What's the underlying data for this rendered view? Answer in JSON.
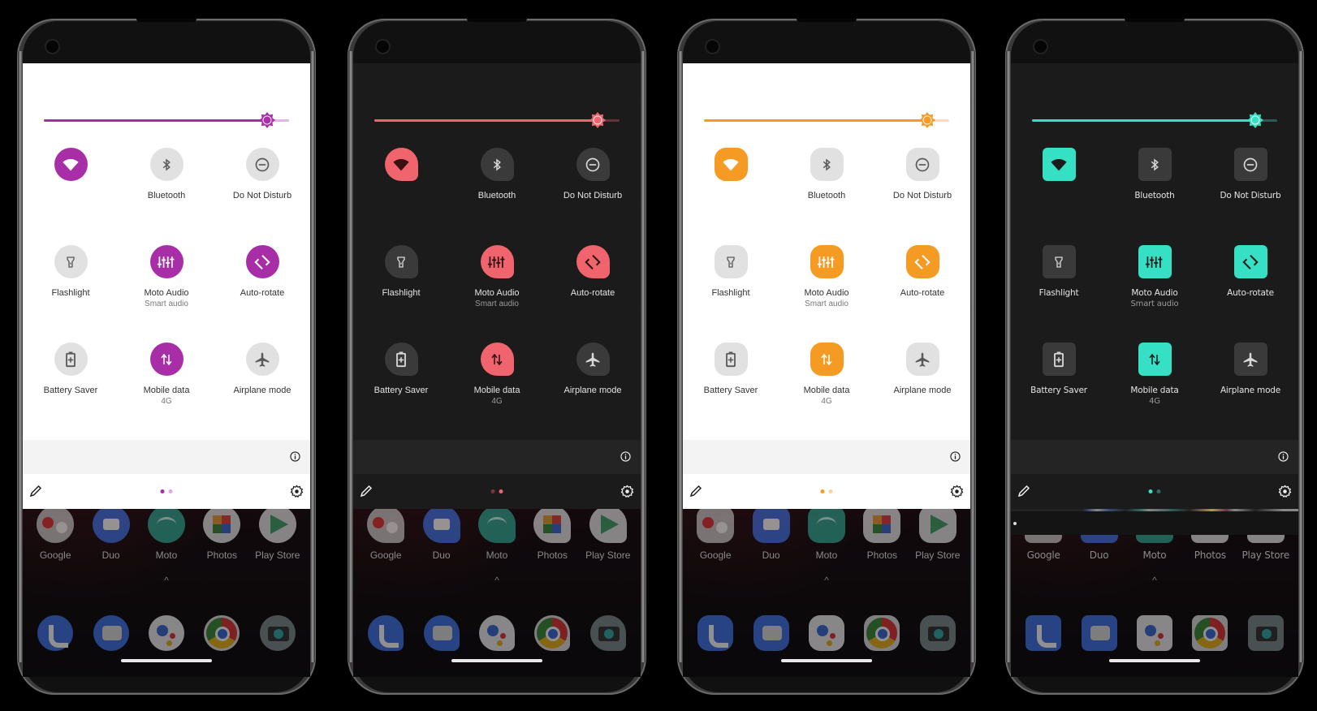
{
  "phones": [
    {
      "theme": "light",
      "shape": "circle",
      "accent": "#a82ea8",
      "accent_dim": "#e2a9e2",
      "brightness": 0.91,
      "tiles": [
        {
          "icon": "wifi",
          "name": "",
          "sub": "",
          "on": true
        },
        {
          "icon": "bluetooth",
          "name": "Bluetooth",
          "sub": "",
          "on": false
        },
        {
          "icon": "dnd",
          "name": "Do Not Disturb",
          "sub": "",
          "on": false
        },
        {
          "icon": "flashlight",
          "name": "Flashlight",
          "sub": "",
          "on": false
        },
        {
          "icon": "equalizer",
          "name": "Moto Audio",
          "sub": "Smart audio",
          "on": true
        },
        {
          "icon": "rotate",
          "name": "Auto-rotate",
          "sub": "",
          "on": true
        },
        {
          "icon": "battery",
          "name": "Battery Saver",
          "sub": "",
          "on": false
        },
        {
          "icon": "data",
          "name": "Mobile data",
          "sub": "4G",
          "on": true
        },
        {
          "icon": "airplane",
          "name": "Airplane mode",
          "sub": "",
          "on": false
        }
      ],
      "page_dots": {
        "count": 2,
        "active": 0
      }
    },
    {
      "theme": "dark",
      "shape": "drop",
      "accent": "#f0656d",
      "accent_dim": "#7a3539",
      "brightness": 0.91,
      "tiles": [
        {
          "icon": "wifi",
          "name": "",
          "sub": "",
          "on": true
        },
        {
          "icon": "bluetooth",
          "name": "Bluetooth",
          "sub": "",
          "on": false
        },
        {
          "icon": "dnd",
          "name": "Do Not Disturb",
          "sub": "",
          "on": false
        },
        {
          "icon": "flashlight",
          "name": "Flashlight",
          "sub": "",
          "on": false
        },
        {
          "icon": "equalizer",
          "name": "Moto Audio",
          "sub": "Smart audio",
          "on": true
        },
        {
          "icon": "rotate",
          "name": "Auto-rotate",
          "sub": "",
          "on": true
        },
        {
          "icon": "battery",
          "name": "Battery Saver",
          "sub": "",
          "on": false
        },
        {
          "icon": "data",
          "name": "Mobile data",
          "sub": "4G",
          "on": true
        },
        {
          "icon": "airplane",
          "name": "Airplane mode",
          "sub": "",
          "on": false
        }
      ],
      "page_dots": {
        "count": 2,
        "active": 1
      }
    },
    {
      "theme": "light",
      "shape": "squircle",
      "accent": "#f59a23",
      "accent_dim": "#f7d3a3",
      "brightness": 0.91,
      "tiles": [
        {
          "icon": "wifi",
          "name": "",
          "sub": "",
          "on": true
        },
        {
          "icon": "bluetooth",
          "name": "Bluetooth",
          "sub": "",
          "on": false
        },
        {
          "icon": "dnd",
          "name": "Do Not Disturb",
          "sub": "",
          "on": false
        },
        {
          "icon": "flashlight",
          "name": "Flashlight",
          "sub": "",
          "on": false
        },
        {
          "icon": "equalizer",
          "name": "Moto Audio",
          "sub": "Smart audio",
          "on": true
        },
        {
          "icon": "rotate",
          "name": "Auto-rotate",
          "sub": "",
          "on": true
        },
        {
          "icon": "battery",
          "name": "Battery Saver",
          "sub": "",
          "on": false
        },
        {
          "icon": "data",
          "name": "Mobile data",
          "sub": "4G",
          "on": true
        },
        {
          "icon": "airplane",
          "name": "Airplane mode",
          "sub": "",
          "on": false
        }
      ],
      "page_dots": {
        "count": 2,
        "active": 0
      }
    },
    {
      "theme": "dark",
      "shape": "square",
      "accent": "#35e0c4",
      "accent_dim": "#2b6e62",
      "brightness": 0.91,
      "alt_font": true,
      "tiles": [
        {
          "icon": "wifi",
          "name": "",
          "sub": "",
          "on": true
        },
        {
          "icon": "bluetooth",
          "name": "Bluetooth",
          "sub": "",
          "on": false
        },
        {
          "icon": "dnd",
          "name": "Do Not Disturb",
          "sub": "",
          "on": false
        },
        {
          "icon": "flashlight",
          "name": "Flashlight",
          "sub": "",
          "on": false
        },
        {
          "icon": "equalizer",
          "name": "Moto Audio",
          "sub": "Smart audio",
          "on": true
        },
        {
          "icon": "rotate",
          "name": "Auto-rotate",
          "sub": "",
          "on": true
        },
        {
          "icon": "battery",
          "name": "Battery Saver",
          "sub": "",
          "on": false
        },
        {
          "icon": "data",
          "name": "Mobile data",
          "sub": "4G",
          "on": true
        },
        {
          "icon": "airplane",
          "name": "Airplane mode",
          "sub": "",
          "on": false
        }
      ],
      "page_dots": {
        "count": 2,
        "active": 0
      }
    }
  ],
  "home": {
    "top_row": [
      {
        "name": "Google",
        "icon": "folder",
        "color": "#c9c9c9"
      },
      {
        "name": "Duo",
        "icon": "duo",
        "color": "#3f74e6"
      },
      {
        "name": "Moto",
        "icon": "moto",
        "color": "#2fa893"
      },
      {
        "name": "Photos",
        "icon": "photos",
        "color": "#e8e8e8"
      },
      {
        "name": "Play Store",
        "icon": "playstore",
        "color": "#e8e8e8"
      }
    ],
    "dock": [
      {
        "name": "Phone",
        "icon": "phone",
        "color": "#3f74e6"
      },
      {
        "name": "Messages",
        "icon": "messages",
        "color": "#3f74e6"
      },
      {
        "name": "Assistant",
        "icon": "assistant",
        "color": "#eeeeee"
      },
      {
        "name": "Chrome",
        "icon": "chrome",
        "color": "#e0e0e0"
      },
      {
        "name": "Camera",
        "icon": "camera",
        "color": "#7c8a8c"
      }
    ],
    "chevron": "^"
  }
}
